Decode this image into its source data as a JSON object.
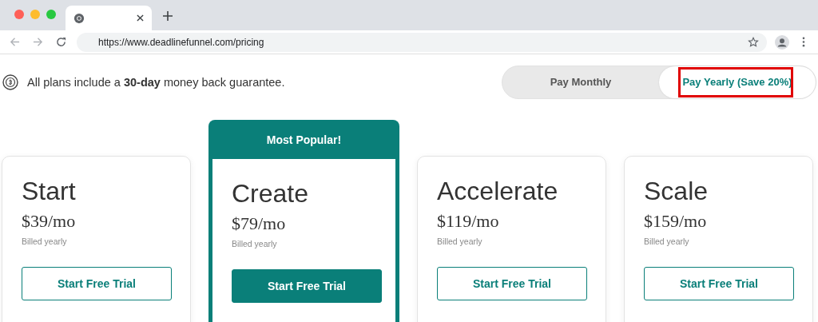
{
  "browser": {
    "url": "https://www.deadlinefunnel.com/pricing"
  },
  "guarantee": {
    "text": "All plans include a **30-day** money back guarantee."
  },
  "billing_toggle": [
    {
      "label": "Pay Monthly",
      "selected": false,
      "highlighted": false
    },
    {
      "label": "Pay Yearly (Save 20%)",
      "selected": true,
      "highlighted": true
    }
  ],
  "plans": [
    {
      "name": "Start",
      "price": "$39/mo",
      "billing": "Billed yearly",
      "button": "Start Free Trial",
      "popular": false
    },
    {
      "name": "Create",
      "price": "$79/mo",
      "billing": "Billed yearly",
      "button": "Start Free Trial",
      "popular": true,
      "badge": "Most Popular!"
    },
    {
      "name": "Accelerate",
      "price": "$119/mo",
      "billing": "Billed yearly",
      "button": "Start Free Trial",
      "popular": false
    },
    {
      "name": "Scale",
      "price": "$159/mo",
      "billing": "Billed yearly",
      "button": "Start Free Trial",
      "popular": false
    }
  ]
}
